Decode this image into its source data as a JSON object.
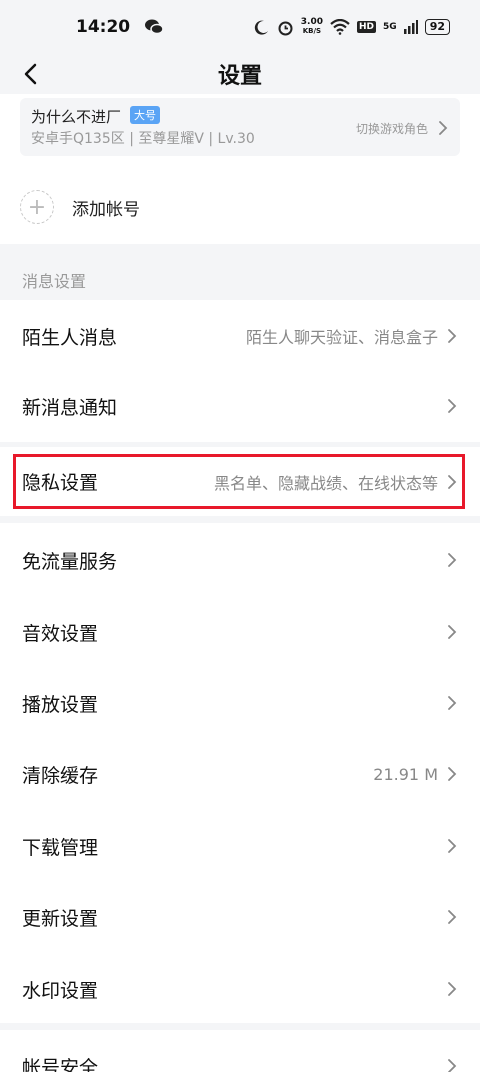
{
  "status_bar": {
    "time": "14:20",
    "speed_value": "3.00",
    "speed_unit": "KB/S",
    "hd": "HD",
    "network": "5G",
    "battery": "92"
  },
  "nav": {
    "title": "设置"
  },
  "account": {
    "name": "为什么不进厂",
    "badge": "大号",
    "info": "安卓手Q135区 | 至尊星耀V | Lv.30",
    "switch_label": "切换游戏角色",
    "add_label": "添加帐号",
    "add_symbol": "+"
  },
  "section_header": "消息设置",
  "rows": {
    "stranger": {
      "label": "陌生人消息",
      "value": "陌生人聊天验证、消息盒子"
    },
    "notify": {
      "label": "新消息通知"
    },
    "privacy": {
      "label": "隐私设置",
      "value": "黑名单、隐藏战绩、在线状态等"
    },
    "data_free": {
      "label": "免流量服务"
    },
    "sound": {
      "label": "音效设置"
    },
    "playback": {
      "label": "播放设置"
    },
    "cache": {
      "label": "清除缓存",
      "value": "21.91 M"
    },
    "download": {
      "label": "下载管理"
    },
    "update": {
      "label": "更新设置"
    },
    "watermark": {
      "label": "水印设置"
    },
    "security": {
      "label": "帐号安全"
    }
  },
  "colors": {
    "highlight": "#e8182a",
    "badge": "#5aa4f5",
    "background": "#f4f5f7"
  }
}
